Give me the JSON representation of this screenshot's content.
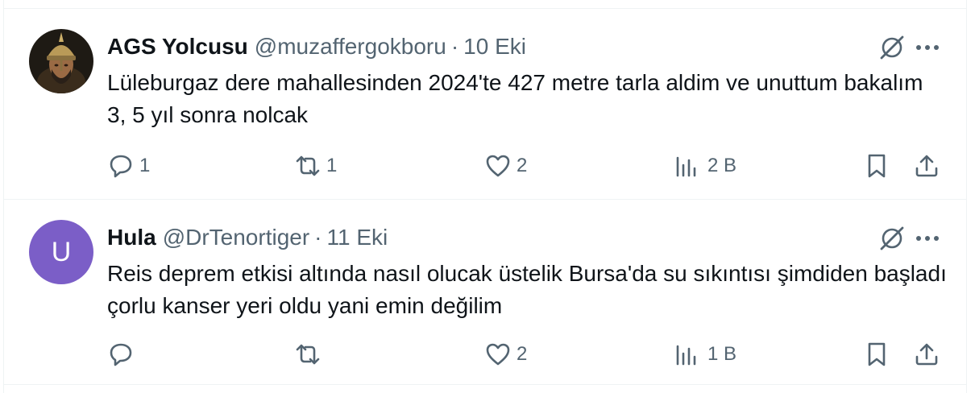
{
  "tweets": [
    {
      "name": "AGS Yolcusu",
      "handle": "@muzaffergokboru",
      "separator": "·",
      "date": "10 Eki",
      "avatar": {
        "type": "image",
        "icon": "helmeted-warrior-avatar"
      },
      "text": "Lüleburgaz dere mahallesinden 2024'te 427 metre tarla aldim ve unuttum bakalım 3, 5 yıl sonra nolcak",
      "replies": "1",
      "retweets": "1",
      "likes": "2",
      "views": "2 B"
    },
    {
      "name": "Hula",
      "handle": "@DrTenortiger",
      "separator": "·",
      "date": "11 Eki",
      "avatar": {
        "type": "letter",
        "letter": "U",
        "color": "#7b5ec7"
      },
      "text": "Reis deprem etkisi altında nasıl olucak üstelik Bursa'da su sıkıntısı şimdiden başladı çorlu kanser yeri oldu yani emin değilim",
      "replies": "",
      "retweets": "",
      "likes": "2",
      "views": "1 B"
    }
  ],
  "icons": {
    "grok": "grok-icon",
    "more": "more-icon",
    "reply": "reply-icon",
    "retweet": "retweet-icon",
    "like": "heart-icon",
    "views": "views-icon",
    "bookmark": "bookmark-icon",
    "share": "share-icon"
  },
  "colors": {
    "text": "#0f1419",
    "secondary": "#536471",
    "divider": "#eff3f4",
    "avatar_letter_bg": "#7b5ec7"
  }
}
